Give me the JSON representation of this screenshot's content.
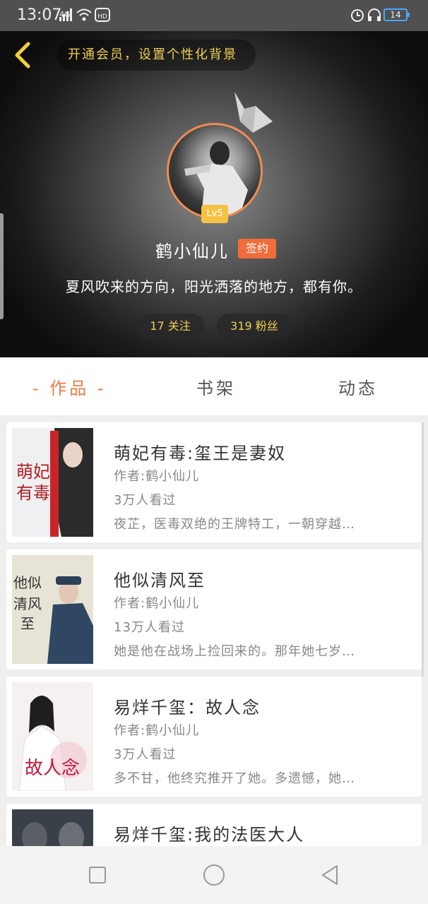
{
  "status_bar": {
    "time": "13:07",
    "network": "4G",
    "battery": "14"
  },
  "header": {
    "vip_prompt": "开通会员，设置个性化背景",
    "level": "Lv5",
    "username": "鹤小仙儿",
    "sign_badge": "签约",
    "motto": "夏风吹来的方向，阳光洒落的地方，都有你。",
    "following": "17 关注",
    "followers": "319 粉丝"
  },
  "tabs": [
    {
      "label": "- 作品 -",
      "active": true
    },
    {
      "label": "书架",
      "active": false
    },
    {
      "label": "动态",
      "active": false
    }
  ],
  "books": [
    {
      "title": "萌妃有毒:玺王是妻奴",
      "author": "作者:鹤小仙儿",
      "views": "3万人看过",
      "desc": "夜芷，医毒双绝的王牌特工，一朝穿越…",
      "cover_text": "萌妃有毒"
    },
    {
      "title": "他似清风至",
      "author": "作者:鹤小仙儿",
      "views": "13万人看过",
      "desc": "她是他在战场上捡回来的。那年她七岁…",
      "cover_text": "他似清风至"
    },
    {
      "title": "易烊千玺：故人念",
      "author": "作者:鹤小仙儿",
      "views": "3万人看过",
      "desc": "多不甘，他终究推开了她。多遗憾，她…",
      "cover_text": "故人念"
    },
    {
      "title": "易烊千玺:我的法医大人",
      "author": "",
      "views": "",
      "desc": "",
      "cover_text": ""
    }
  ],
  "colors": {
    "accent": "#f07a3f",
    "gold": "#f1cf52",
    "sign": "#f06c3a"
  }
}
